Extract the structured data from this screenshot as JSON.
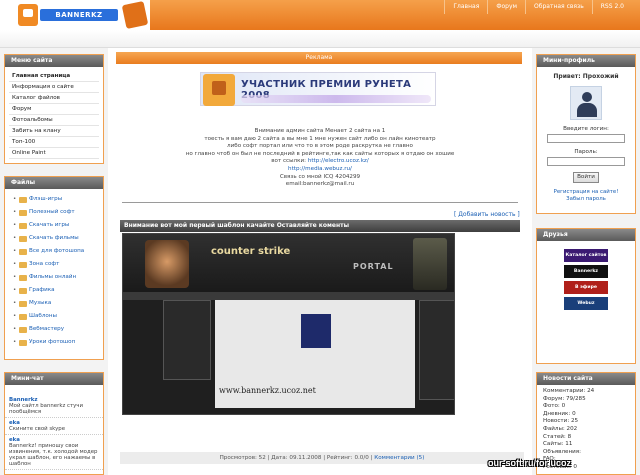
{
  "header": {
    "logo_text": "BANNERKZ",
    "nav": [
      "Главная",
      "Форум",
      "Обратная связь",
      "RSS 2.0"
    ]
  },
  "left": {
    "menu_title": "Меню сайта",
    "menu_items": [
      "Главная страница",
      "Информация о сайте",
      "Каталог файлов",
      "Форум",
      "Фотоальбомы",
      "Забить на клану",
      "Топ-100",
      "Online Paint"
    ],
    "folders_title": "Файлы",
    "folders": [
      "Флэш-игры",
      "Полезный софт",
      "Скачать игры",
      "Скачать фильмы",
      "Все для фотошопа",
      "Зона софт",
      "Фильмы онлайн",
      "Графика",
      "Музыка",
      "Шаблоны",
      "Вебмастеру",
      "Уроки фотошоп"
    ],
    "chat_title": "Мини-чат",
    "chat": [
      {
        "user": "Bannerkz",
        "text": "Мой сайтл bannerkz стучи пообщёмся"
      },
      {
        "user": "eka",
        "text": "Скините свой skype"
      },
      {
        "user": "eka",
        "text": "Bannerkz! приношу свои извинения, т.к. холодой модер украл шаблон, его нажаемы в шаблон"
      }
    ]
  },
  "middle": {
    "ads_label": "Реклама",
    "banner_text": "УЧАСТНИК ПРЕМИИ РУНЕТА 2008",
    "notice_lines": [
      "Внимание админ сайта Менает 2 сайта на 1",
      "тоесть я вам даю 2 сайта а вы мне 1 мне нужен сайт либо он лайн кинотеатр",
      "либо софт портал или что то в этом роде раскрутка не главно",
      "но главно чтоб он был не последний в рейтинге,так как сайты которых я отдаю он хошие",
      "вот ссылки:"
    ],
    "notice_link1": "http://electro.ucoz.kz/",
    "notice_link2": "http://media.webuz.ru/",
    "notice_contact1": "Связь со мной ICQ 4204299",
    "notice_contact2": "email:bannerkz@mail.ru",
    "add_news": "[ Добавить новость ]",
    "news_title": "Внимание вот мой первый шаблон качайте Оставляйте коменты",
    "shot_brand": "counter strike",
    "shot_portal": "PORTAL",
    "shot_url": "www.bannerkz.ucoz.net",
    "footer_prefix": "Просмотров: 52 | Дата: 09.11.2008 | Рейтинг: 0.0/0 |",
    "footer_comments": "Комментарии (5)"
  },
  "right": {
    "profile_title": "Мини-профиль",
    "greeting": "Привет: Прохожий",
    "login_label": "Введите логин:",
    "password_label": "Пароль:",
    "login_button": "Войти",
    "register_link": "Регистрация на сайте!",
    "forgot_link": "Забыл пароль",
    "friends_title": "Друзья",
    "friends": [
      {
        "label": "Каталог сайтов",
        "color": "#3b1a72"
      },
      {
        "label": "Bannerkz",
        "color": "#101010"
      },
      {
        "label": "В эфире",
        "color": "#b0201a"
      },
      {
        "label": "Webuz",
        "color": "#1a3f7a"
      }
    ],
    "stats_title": "Новости сайта",
    "stats": [
      "Комментарии: 24",
      "Форум: 79/285",
      "Фото: 0",
      "Дневник: 0",
      "Новости: 25",
      "Файлы: 202",
      "Статей: 8",
      "Сайты: 11",
      "Объявления:",
      "FAQ:",
      "Гостевая: 0"
    ]
  },
  "watermark": "our-soft.ru/for ucoz"
}
